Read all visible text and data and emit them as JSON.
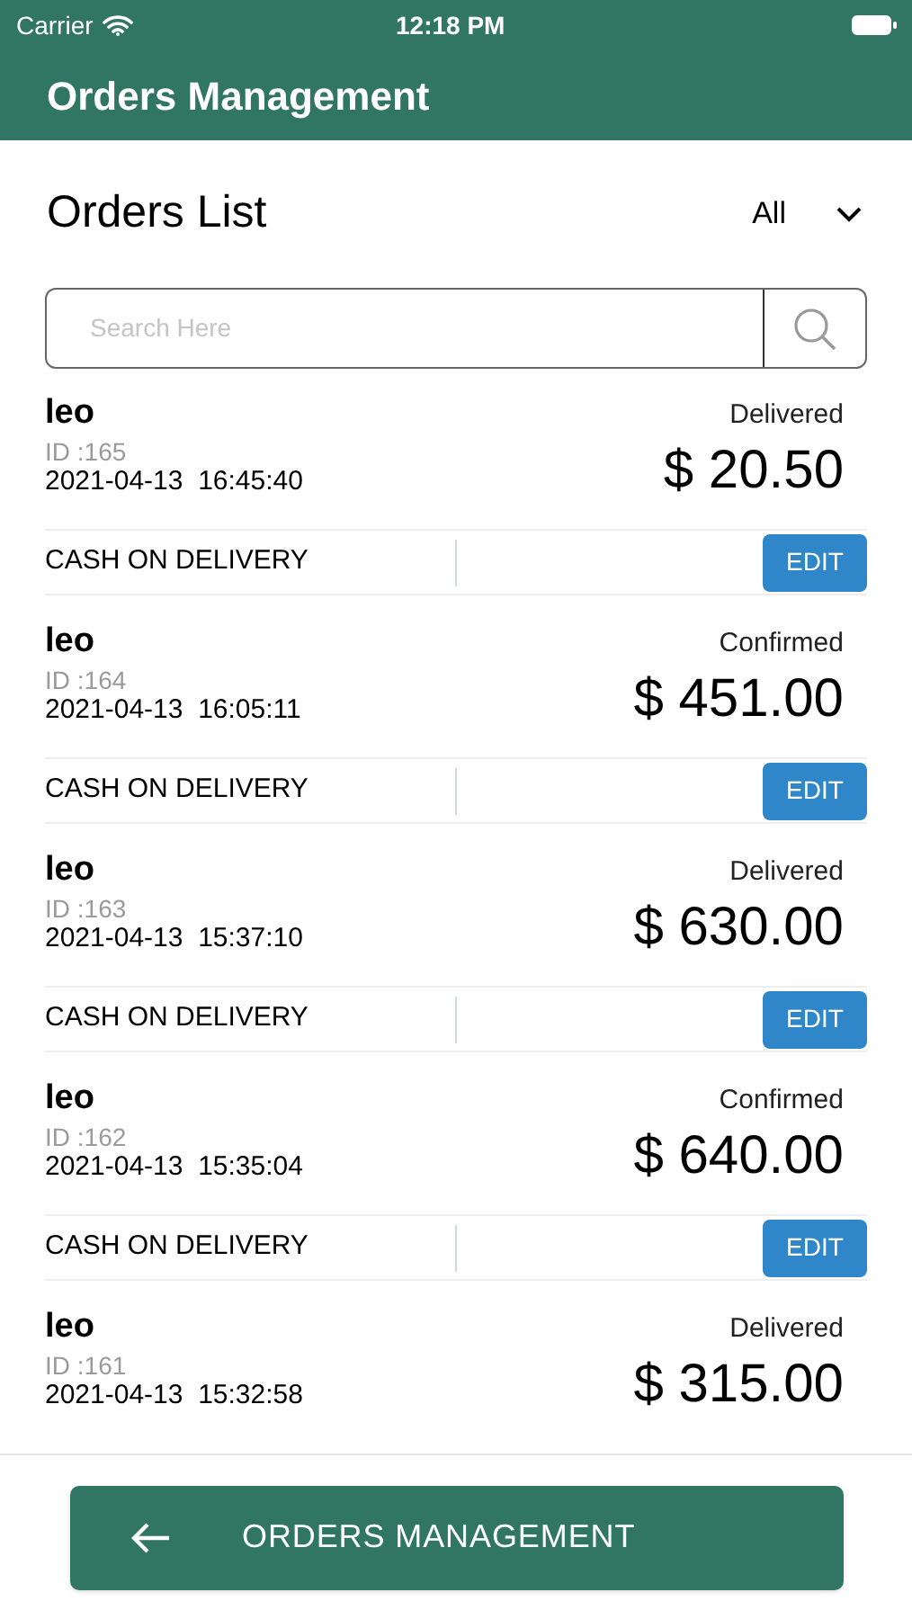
{
  "status_bar": {
    "carrier": "Carrier",
    "time": "12:18 PM"
  },
  "header": {
    "title": "Orders Management"
  },
  "list_title": "Orders List",
  "filter": {
    "value": "All"
  },
  "search": {
    "placeholder": "Search Here"
  },
  "orders": [
    {
      "name": "leo",
      "id": "ID :165",
      "datetime": "2021-04-13  16:45:40",
      "status": "Delivered",
      "amount": "$ 20.50",
      "payment": "CASH ON DELIVERY",
      "edit": "EDIT"
    },
    {
      "name": "leo",
      "id": "ID :164",
      "datetime": "2021-04-13  16:05:11",
      "status": "Confirmed",
      "amount": "$ 451.00",
      "payment": "CASH ON DELIVERY",
      "edit": "EDIT"
    },
    {
      "name": "leo",
      "id": "ID :163",
      "datetime": "2021-04-13  15:37:10",
      "status": "Delivered",
      "amount": "$ 630.00",
      "payment": "CASH ON DELIVERY",
      "edit": "EDIT"
    },
    {
      "name": "leo",
      "id": "ID :162",
      "datetime": "2021-04-13  15:35:04",
      "status": "Confirmed",
      "amount": "$ 640.00",
      "payment": "CASH ON DELIVERY",
      "edit": "EDIT"
    },
    {
      "name": "leo",
      "id": "ID :161",
      "datetime": "2021-04-13  15:32:58",
      "status": "Delivered",
      "amount": "$ 315.00"
    }
  ],
  "bottom_button": {
    "label": "ORDERS MANAGEMENT"
  }
}
